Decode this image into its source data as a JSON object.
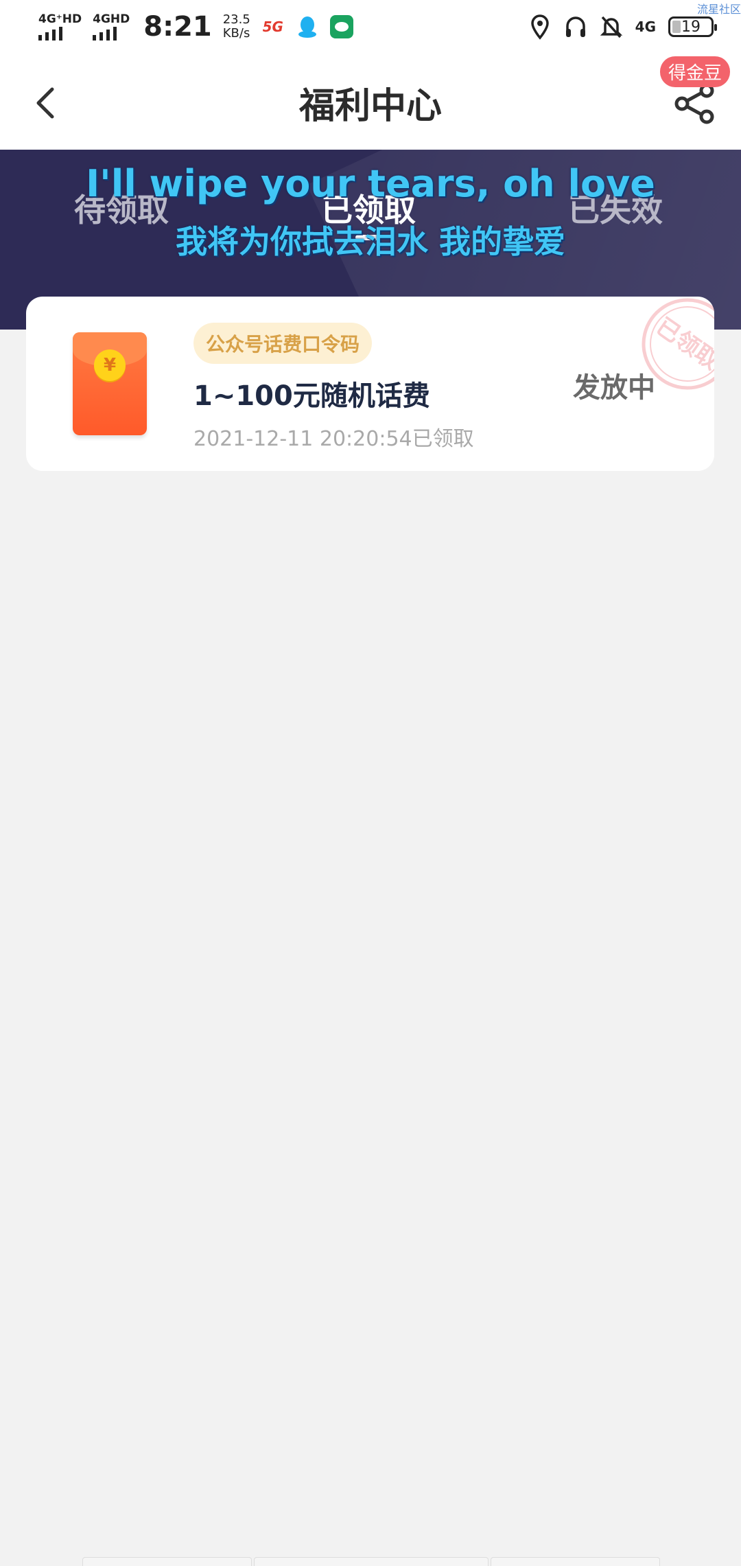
{
  "status_bar": {
    "sim1_label": "4G⁺HD",
    "sim2_label": "4GHD",
    "time": "8:21",
    "speed_value": "23.5",
    "speed_unit": "KB/s",
    "icon_5g": "5G",
    "net_label": "4G",
    "battery": "19",
    "corner_text": "流星社区"
  },
  "header": {
    "title": "福利中心",
    "badge": "得金豆"
  },
  "tabs": [
    {
      "label": "待领取",
      "active": false
    },
    {
      "label": "已领取",
      "active": true
    },
    {
      "label": "已失效",
      "active": false
    }
  ],
  "overlay_lyrics": {
    "english": "I'll wipe your tears, oh love",
    "chinese": "我将为你拭去泪水 我的挚爱"
  },
  "card": {
    "coin_symbol": "¥",
    "tag": "公众号话费口令码",
    "prize": "1~100元随机话费",
    "timestamp": "2021-12-11 20:20:54已领取",
    "status": "发放中",
    "stamp_text": "已领取"
  },
  "colors": {
    "banner": "#2e2b56",
    "lyrics": "#41c6f5",
    "badge": "#f3636b",
    "tag_bg": "#fdf0d3",
    "tag_text": "#d8a148",
    "envelope": "#ff5a2a"
  }
}
